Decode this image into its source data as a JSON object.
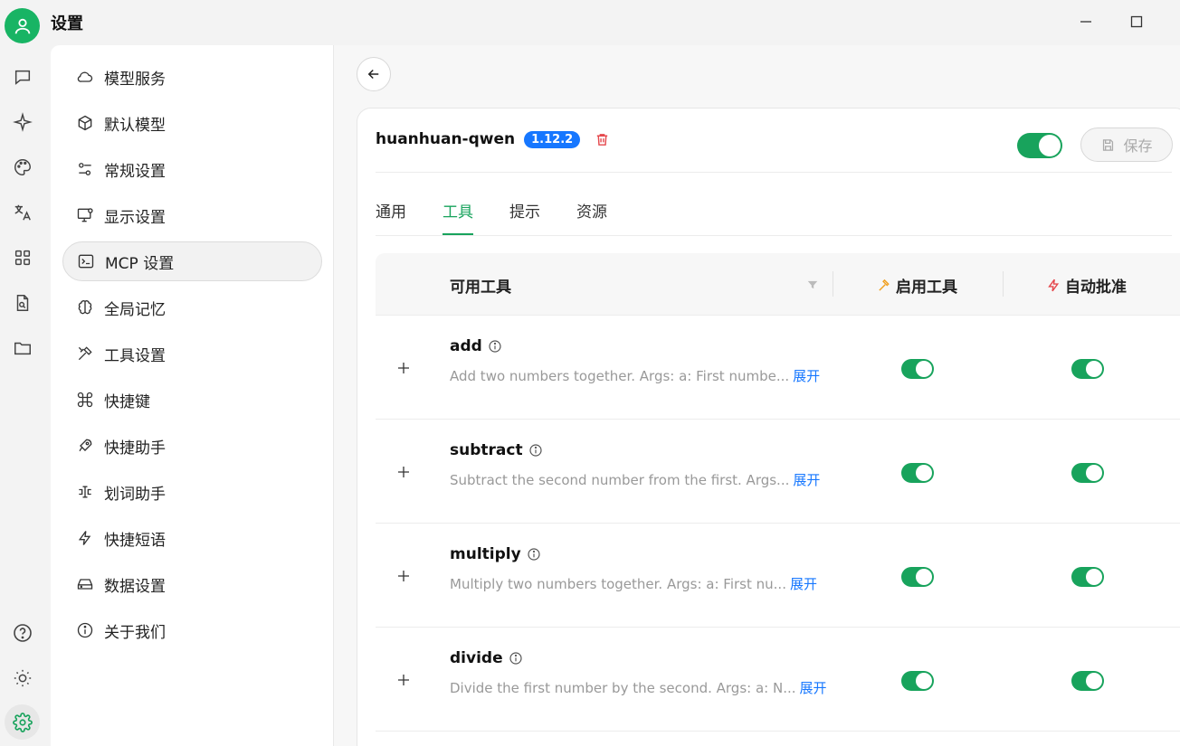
{
  "app": {
    "title": "设置"
  },
  "window": {
    "minimize_icon": "minimize-icon",
    "maximize_icon": "maximize-icon"
  },
  "rail": {
    "items": [
      {
        "icon": "chat-icon"
      },
      {
        "icon": "sparkle-icon"
      },
      {
        "icon": "palette-icon"
      },
      {
        "icon": "translate-icon"
      },
      {
        "icon": "apps-grid-icon"
      },
      {
        "icon": "doc-search-icon"
      },
      {
        "icon": "folder-icon"
      }
    ],
    "bottom": [
      {
        "icon": "help-icon"
      },
      {
        "icon": "theme-sun-icon"
      },
      {
        "icon": "settings-gear-icon"
      }
    ]
  },
  "sidebar": {
    "items": [
      {
        "label": "模型服务",
        "icon": "cloud-icon"
      },
      {
        "label": "默认模型",
        "icon": "cube-icon"
      },
      {
        "label": "常规设置",
        "icon": "sliders-icon"
      },
      {
        "label": "显示设置",
        "icon": "monitor-icon"
      },
      {
        "label": "MCP 设置",
        "icon": "terminal-icon",
        "active": true
      },
      {
        "label": "全局记忆",
        "icon": "brain-icon"
      },
      {
        "label": "工具设置",
        "icon": "tools-icon"
      },
      {
        "label": "快捷键",
        "icon": "command-icon"
      },
      {
        "label": "快捷助手",
        "icon": "rocket-icon"
      },
      {
        "label": "划词助手",
        "icon": "text-select-icon"
      },
      {
        "label": "快捷短语",
        "icon": "zap-icon"
      },
      {
        "label": "数据设置",
        "icon": "drive-icon"
      },
      {
        "label": "关于我们",
        "icon": "info-icon"
      }
    ]
  },
  "server": {
    "name": "huanhuan-qwen",
    "version": "1.12.2",
    "enabled": true,
    "save_label": "保存"
  },
  "tabs": [
    {
      "label": "通用"
    },
    {
      "label": "工具",
      "active": true
    },
    {
      "label": "提示"
    },
    {
      "label": "资源"
    }
  ],
  "table": {
    "headers": {
      "name": "可用工具",
      "enable": "启用工具",
      "auto_approve": "自动批准"
    },
    "expand_label": "展开",
    "rows": [
      {
        "name": "add",
        "description": "Add two numbers together. Args: a: First numbe...",
        "enabled": true,
        "auto_approve": true
      },
      {
        "name": "subtract",
        "description": "Subtract the second number from the first. Args...",
        "enabled": true,
        "auto_approve": true
      },
      {
        "name": "multiply",
        "description": "Multiply two numbers together. Args: a: First nu...",
        "enabled": true,
        "auto_approve": true
      },
      {
        "name": "divide",
        "description": "Divide the first number by the second. Args: a: N...",
        "enabled": true,
        "auto_approve": true
      }
    ]
  },
  "colors": {
    "accent": "#18a35c",
    "badge": "#1677ff",
    "danger": "#e5484d",
    "enable_icon": "#f0a020",
    "auto_icon": "#e5484d"
  }
}
